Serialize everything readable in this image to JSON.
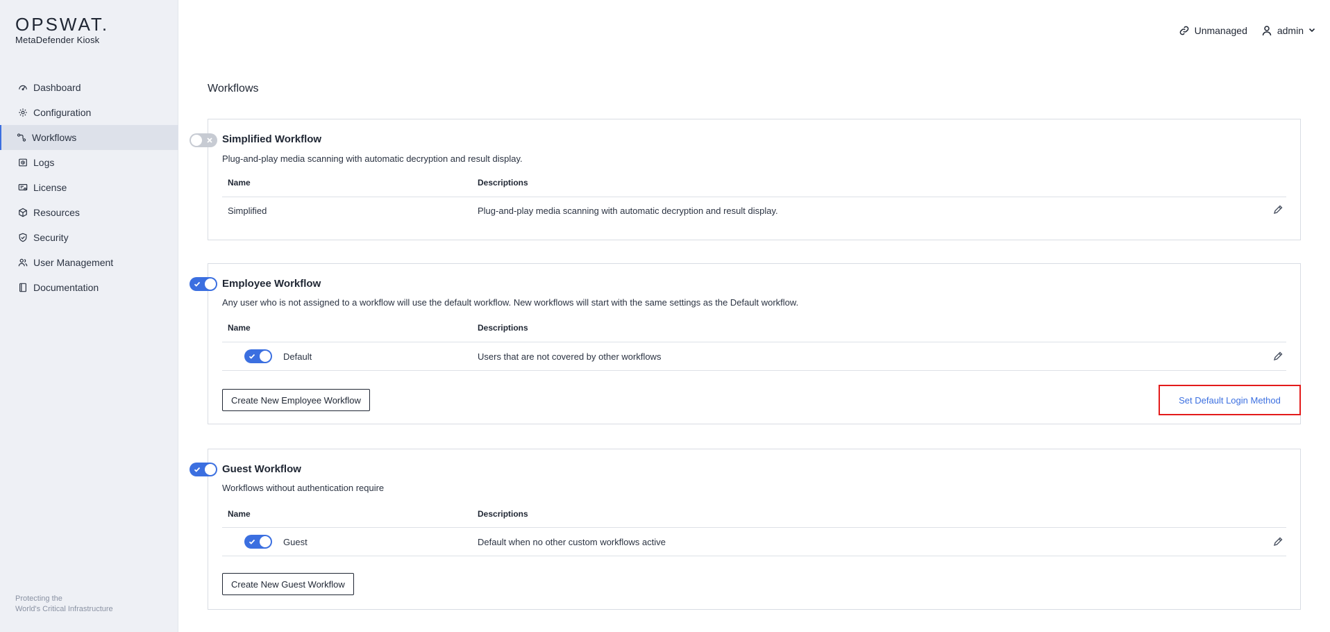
{
  "brand": {
    "logo": "OPSWAT.",
    "product": "MetaDefender Kiosk"
  },
  "nav": [
    {
      "label": "Dashboard",
      "icon": "dashboard-icon",
      "active": false
    },
    {
      "label": "Configuration",
      "icon": "gear-icon",
      "active": false
    },
    {
      "label": "Workflows",
      "icon": "workflow-icon",
      "active": true
    },
    {
      "label": "Logs",
      "icon": "logs-icon",
      "active": false
    },
    {
      "label": "License",
      "icon": "license-icon",
      "active": false
    },
    {
      "label": "Resources",
      "icon": "cube-icon",
      "active": false
    },
    {
      "label": "Security",
      "icon": "shield-icon",
      "active": false
    },
    {
      "label": "User Management",
      "icon": "users-icon",
      "active": false
    },
    {
      "label": "Documentation",
      "icon": "book-icon",
      "active": false
    }
  ],
  "footer": {
    "line1": "Protecting the",
    "line2": "World's Critical Infrastructure"
  },
  "header": {
    "status": "Unmanaged",
    "user": "admin"
  },
  "page_title": "Workflows",
  "columns": {
    "name": "Name",
    "descriptions": "Descriptions"
  },
  "simplified": {
    "title": "Simplified Workflow",
    "desc": "Plug-and-play media scanning with automatic decryption and result display.",
    "enabled": false,
    "row": {
      "name": "Simplified",
      "desc": "Plug-and-play media scanning with automatic decryption and result display."
    }
  },
  "employee": {
    "title": "Employee Workflow",
    "desc": "Any user who is not assigned to a workflow will use the default workflow. New workflows will start with the same settings as the Default workflow.",
    "enabled": true,
    "row": {
      "name": "Default",
      "desc": "Users that are not covered by other workflows",
      "enabled": true
    },
    "create_label": "Create New Employee Workflow",
    "login_method_label": "Set Default Login Method"
  },
  "guest": {
    "title": "Guest Workflow",
    "desc": "Workflows without authentication require",
    "enabled": true,
    "row": {
      "name": "Guest",
      "desc": "Default when no other custom workflows active",
      "enabled": true
    },
    "create_label": "Create New Guest Workflow"
  },
  "colors": {
    "accent": "#3b6fe0",
    "highlight": "#e31b1b",
    "sidebar_bg": "#eef0f5"
  }
}
